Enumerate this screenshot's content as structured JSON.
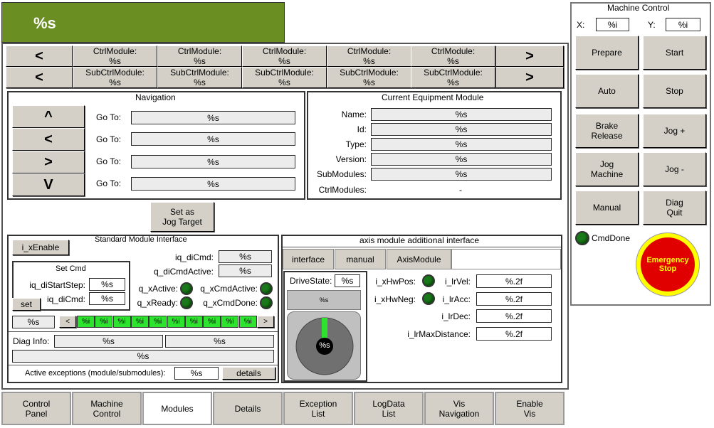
{
  "header": {
    "title": "%s",
    "color": "#6b8e23"
  },
  "breadcrumb": {
    "prev": "<",
    "next": ">",
    "ctrl": [
      "CtrlModule:\n%s",
      "CtrlModule:\n%s",
      "CtrlModule:\n%s",
      "CtrlModule:\n%s",
      "CtrlModule:\n%s"
    ],
    "sub": [
      "SubCtrlModule:\n%s",
      "SubCtrlModule:\n%s",
      "SubCtrlModule:\n%s",
      "SubCtrlModule:\n%s",
      "SubCtrlModule:\n%s"
    ]
  },
  "navigation": {
    "title": "Navigation",
    "buttons": [
      "^",
      "<",
      ">",
      "V"
    ],
    "goto_label": "Go To:",
    "goto_values": [
      "%s",
      "%s",
      "%s",
      "%s"
    ],
    "jog_target": "Set as\nJog Target"
  },
  "equipment": {
    "title": "Current Equipment Module",
    "rows": [
      {
        "label": "Name:",
        "value": "%s"
      },
      {
        "label": "Id:",
        "value": "%s"
      },
      {
        "label": "Type:",
        "value": "%s"
      },
      {
        "label": "Version:",
        "value": "%s"
      },
      {
        "label": "SubModules:",
        "value": "%s"
      },
      {
        "label": "CtrlModules:",
        "value": "-"
      }
    ]
  },
  "smi": {
    "title": "Standard Module Interface",
    "xenable": "i_xEnable",
    "setcmd_title": "Set Cmd",
    "start_step_label": "iq_diStartStep:",
    "start_step": "%s",
    "dicmd_label": "iq_diCmd:",
    "dicmd": "%s",
    "set": "set",
    "iqdicmd_label": "iq_diCmd:",
    "iqdicmd": "%s",
    "qdicmdactive_label": "q_diCmdActive:",
    "qdicmdactive": "%s",
    "xactive": "q_xActive:",
    "xcmdactive": "q_xCmdActive:",
    "xready": "q_xReady:",
    "xcmddone": "q_xCmdDone:",
    "step_value": "%s",
    "step_prev": "<",
    "step_next": ">",
    "steps": [
      "%i",
      "%i",
      "%i",
      "%i",
      "%i",
      "%i",
      "%i",
      "%i",
      "%i",
      "%i"
    ],
    "diag_label": "Diag Info:",
    "diag1": "%s",
    "diag2": "%s",
    "diag3": "%s",
    "exc_label": "Active exceptions (module/submodules):",
    "exc_value": "%s",
    "details": "details"
  },
  "axis": {
    "title": "axis module additional interface",
    "tabs": [
      "interface",
      "manual",
      "AxisModule"
    ],
    "drivestate_label": "DriveState:",
    "drivestate": "%s",
    "drive_bar": "%s",
    "dial_value": "%s",
    "hwpos": "i_xHwPos:",
    "hwneg": "i_xHwNeg:",
    "rows": [
      {
        "label": "i_lrVel:",
        "value": "%.2f"
      },
      {
        "label": "i_lrAcc:",
        "value": "%.2f"
      },
      {
        "label": "i_lrDec:",
        "value": "%.2f"
      },
      {
        "label": "i_lrMaxDistance:",
        "value": "%.2f"
      }
    ]
  },
  "machine": {
    "title": "Machine Control",
    "x_label": "X:",
    "x": "%i",
    "y_label": "Y:",
    "y": "%i",
    "buttons": [
      "Prepare",
      "Start",
      "Auto",
      "Stop",
      "Brake\nRelease",
      "Jog +",
      "Jog\nMachine",
      "Jog -",
      "Manual",
      "Diag\nQuit"
    ],
    "cmddone": "CmdDone",
    "estop": "Emergency\nStop"
  },
  "bottom_tabs": [
    "Control\nPanel",
    "Machine\nControl",
    "Modules",
    "Details",
    "Exception\nList",
    "LogData\nList",
    "Vis\nNavigation",
    "Enable\nVis"
  ]
}
